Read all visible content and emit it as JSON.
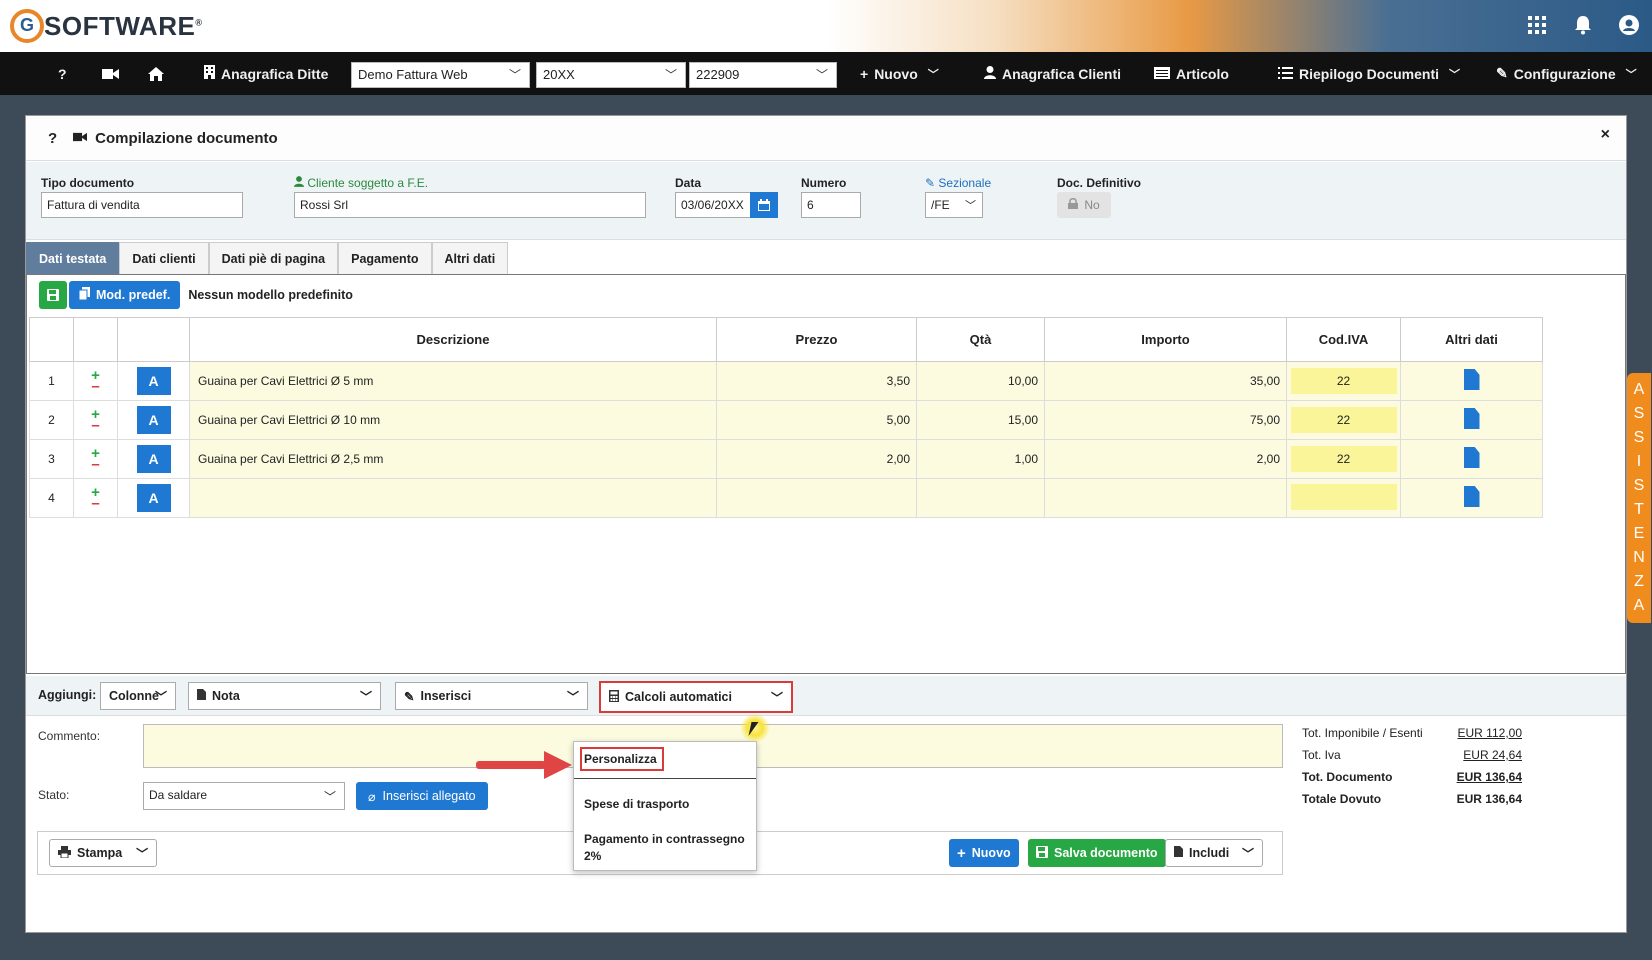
{
  "brand": {
    "logo_g": "G",
    "logo_text": "SOFTWARE",
    "logo_reg": "®"
  },
  "nav": {
    "help": "?",
    "anagrafica_ditte": "Anagrafica Ditte",
    "select_ditta": "Demo Fattura Web",
    "select_anno": "20XX",
    "select_codice": "222909",
    "nuovo": "Nuovo",
    "anagrafica_clienti": "Anagrafica Clienti",
    "articolo": "Articolo",
    "riepilogo": "Riepilogo Documenti",
    "configurazione": "Configurazione"
  },
  "panel": {
    "help": "?",
    "title": "Compilazione documento",
    "close": "×"
  },
  "header": {
    "tipo_label": "Tipo documento",
    "tipo_value": "Fattura di vendita",
    "cliente_label": "Cliente soggetto a F.E.",
    "cliente_value": "Rossi Srl",
    "data_label": "Data",
    "data_value": "03/06/20XX",
    "numero_label": "Numero",
    "numero_value": "6",
    "sezionale_label": "Sezionale",
    "sezionale_value": "/FE",
    "def_label": "Doc. Definitivo",
    "def_value": "No"
  },
  "tabs": [
    "Dati testata",
    "Dati clienti",
    "Dati piè di pagina",
    "Pagamento",
    "Altri dati"
  ],
  "grid": {
    "mod_predef": "Mod. predef.",
    "no_model": "Nessun modello predefinito",
    "columns": [
      "Descrizione",
      "Prezzo",
      "Qtà",
      "Importo",
      "Cod.IVA",
      "Altri dati"
    ],
    "row_btn": "A",
    "rows": [
      {
        "n": "1",
        "descrizione": "Guaina per Cavi Elettrici Ø 5 mm",
        "prezzo": "3,50",
        "qta": "10,00",
        "importo": "35,00",
        "iva": "22"
      },
      {
        "n": "2",
        "descrizione": "Guaina per Cavi Elettrici Ø 10 mm",
        "prezzo": "5,00",
        "qta": "15,00",
        "importo": "75,00",
        "iva": "22"
      },
      {
        "n": "3",
        "descrizione": "Guaina per Cavi Elettrici Ø 2,5 mm",
        "prezzo": "2,00",
        "qta": "1,00",
        "importo": "2,00",
        "iva": "22"
      },
      {
        "n": "4",
        "descrizione": "",
        "prezzo": "",
        "qta": "",
        "importo": "",
        "iva": ""
      }
    ]
  },
  "addbar": {
    "label": "Aggiungi:",
    "colonne": "Colonne",
    "nota": "Nota",
    "inserisci": "Inserisci",
    "calcoli": "Calcoli automatici"
  },
  "dropdown": {
    "personalizza": "Personalizza",
    "spese": "Spese di trasporto",
    "contrassegno_1": "Pagamento in contrassegno",
    "contrassegno_2": "2%"
  },
  "bottom": {
    "commento_label": "Commento:",
    "stato_label": "Stato:",
    "stato_value": "Da saldare",
    "allegato": "Inserisci allegato"
  },
  "totals": {
    "imponibile_label": "Tot. Imponibile / Esenti",
    "imponibile_value": "EUR 112,00",
    "iva_label": "Tot. Iva",
    "iva_value": "EUR 24,64",
    "documento_label": "Tot. Documento",
    "documento_value": "EUR 136,64",
    "dovuto_label": "Totale Dovuto",
    "dovuto_value": "EUR 136,64"
  },
  "footer": {
    "stampa": "Stampa",
    "nuovo": "Nuovo",
    "salva": "Salva documento",
    "includi": "Includi"
  },
  "assistenza": [
    "A",
    "S",
    "S",
    "I",
    "S",
    "T",
    "E",
    "N",
    "Z",
    "A"
  ]
}
